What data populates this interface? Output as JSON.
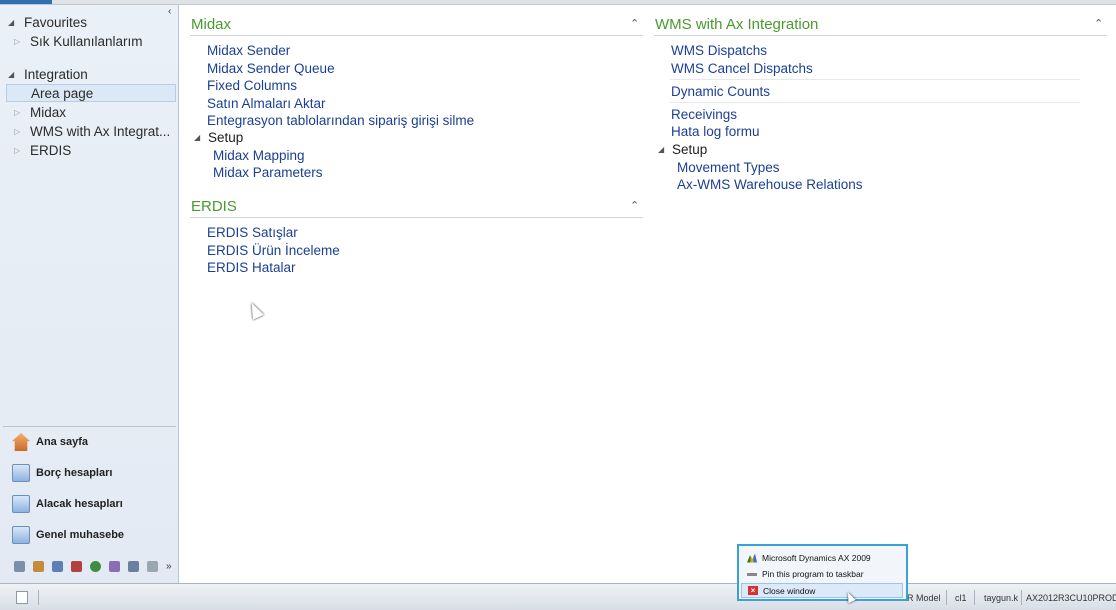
{
  "nav": {
    "favourites": {
      "label": "Favourites",
      "items": [
        "Sık Kullanılanlarım"
      ]
    },
    "integration": {
      "label": "Integration",
      "items": [
        "Area page",
        "Midax",
        "WMS with Ax Integrat...",
        "ERDIS"
      ]
    },
    "buttons": [
      "Ana sayfa",
      "Borç hesapları",
      "Alacak hesapları",
      "Genel muhasebe"
    ],
    "small_icons": [
      "fixed-assets-icon",
      "inventory-icon",
      "production-icon",
      "reports-icon",
      "globe-icon",
      "people-icon",
      "users-icon",
      "settings-icon",
      "more-icon"
    ]
  },
  "groups": {
    "midax": {
      "title": "Midax",
      "links": [
        "Midax Sender",
        "Midax Sender Queue",
        "Fixed Columns",
        "Satın Almaları Aktar",
        "Entegrasyon tablolarından sipariş girişi silme"
      ],
      "setup": {
        "label": "Setup",
        "links": [
          "Midax Mapping",
          "Midax Parameters"
        ]
      }
    },
    "erdis": {
      "title": "ERDIS",
      "links": [
        "ERDIS Satışlar",
        "ERDIS Ürün İnceleme",
        "ERDIS Hatalar"
      ]
    },
    "wms": {
      "title": "WMS with Ax Integration",
      "links_a": [
        "WMS Dispatchs",
        "WMS Cancel Dispatchs"
      ],
      "links_b": [
        "Dynamic Counts"
      ],
      "links_c": [
        "Receivings",
        "Hata log formu"
      ],
      "setup": {
        "label": "Setup",
        "links": [
          "Movement Types",
          "Ax-WMS Warehouse Relations"
        ]
      }
    }
  },
  "status": {
    "model": "R Model",
    "company": "cl1",
    "user": "taygun.k",
    "server": "AX2012R3CU10PROD ..."
  },
  "jumplist": {
    "app": "Microsoft Dynamics AX 2009",
    "pin": "Pin this program to taskbar",
    "close": "Close window"
  }
}
